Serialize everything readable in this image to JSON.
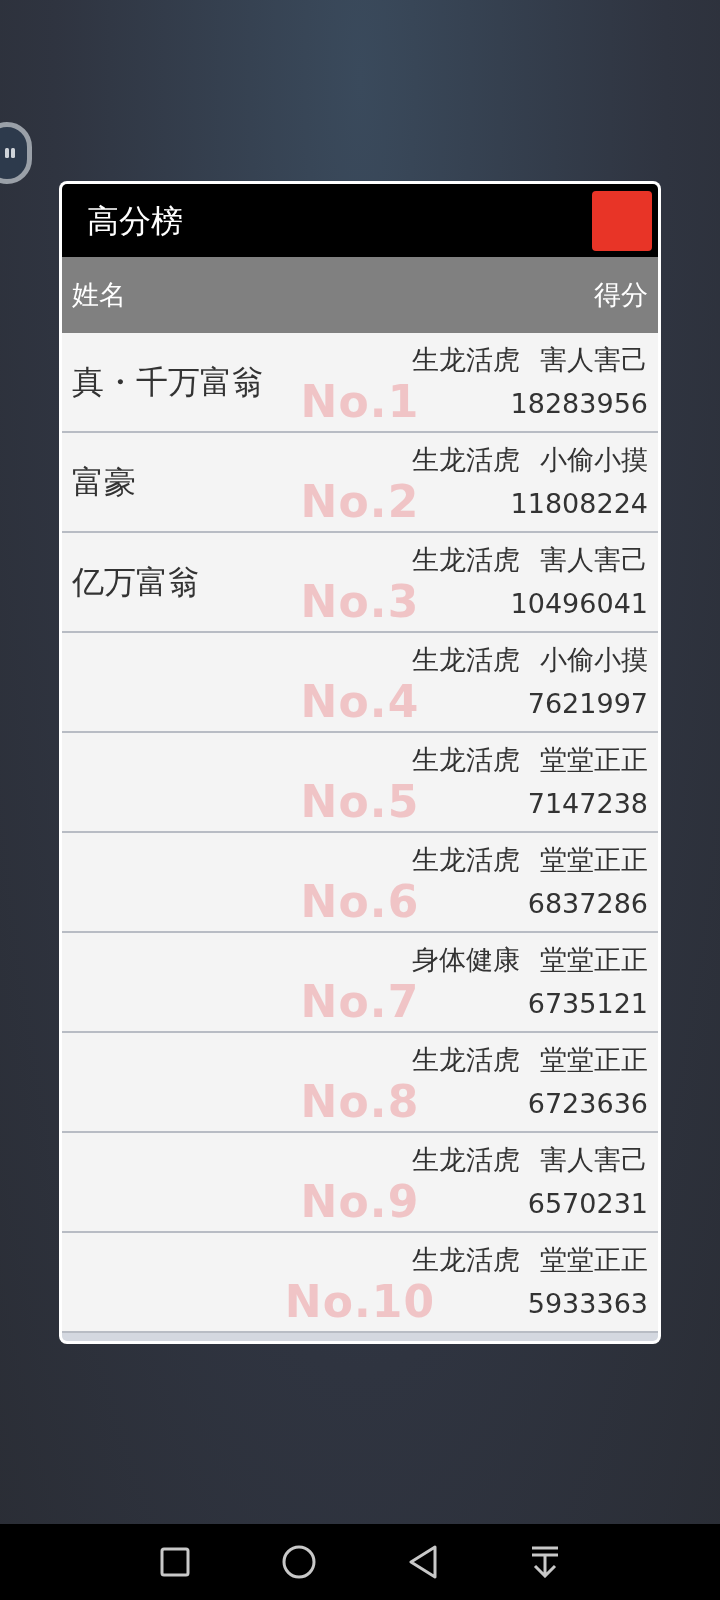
{
  "dialog": {
    "title": "高分榜",
    "columns": [
      "姓名",
      "得分"
    ],
    "rows": [
      {
        "rank": "No.1",
        "name": "真・千万富翁",
        "tags": [
          "生龙活虎",
          "害人害己"
        ],
        "score": "18283956"
      },
      {
        "rank": "No.2",
        "name": "富豪",
        "tags": [
          "生龙活虎",
          "小偷小摸"
        ],
        "score": "11808224"
      },
      {
        "rank": "No.3",
        "name": "亿万富翁",
        "tags": [
          "生龙活虎",
          "害人害己"
        ],
        "score": "10496041"
      },
      {
        "rank": "No.4",
        "tags": [
          "生龙活虎",
          "小偷小摸"
        ],
        "score": "7621997"
      },
      {
        "rank": "No.5",
        "tags": [
          "生龙活虎",
          "堂堂正正"
        ],
        "score": "7147238"
      },
      {
        "rank": "No.6",
        "tags": [
          "生龙活虎",
          "堂堂正正"
        ],
        "score": "6837286"
      },
      {
        "rank": "No.7",
        "tags": [
          "身体健康",
          "堂堂正正"
        ],
        "score": "6735121"
      },
      {
        "rank": "No.8",
        "tags": [
          "生龙活虎",
          "堂堂正正"
        ],
        "score": "6723636"
      },
      {
        "rank": "No.9",
        "tags": [
          "生龙活虎",
          "害人害己"
        ],
        "score": "6570231"
      },
      {
        "rank": "No.10",
        "tags": [
          "生龙活虎",
          "堂堂正正"
        ],
        "score": "5933363"
      }
    ]
  }
}
